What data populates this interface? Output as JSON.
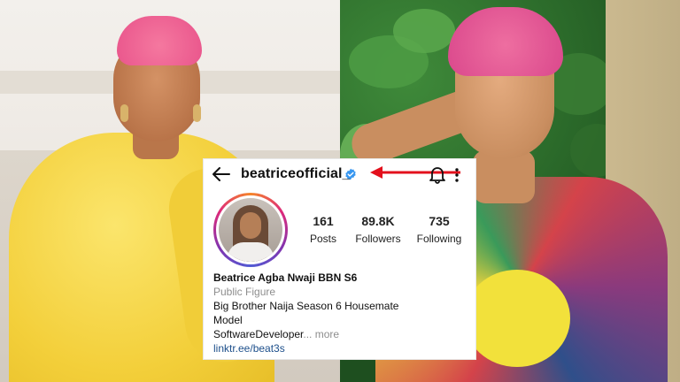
{
  "profile": {
    "username": "beatriceofficial_",
    "verified": true,
    "stats": {
      "posts": {
        "value": "161",
        "label": "Posts"
      },
      "followers": {
        "value": "89.8K",
        "label": "Followers"
      },
      "following": {
        "value": "735",
        "label": "Following"
      }
    },
    "bio": {
      "name": "Beatrice Agba Nwaji BBN S6",
      "category": "Public Figure",
      "line1": "Big Brother Naija Season 6 Housemate",
      "line2": "Model",
      "line3": "SoftwareDeveloper",
      "ellipsis": "...",
      "more": "more",
      "link": "linktr.ee/beat3s"
    }
  },
  "icons": {
    "back": "arrow-left-icon",
    "verified": "verified-badge-icon",
    "bell": "bell-icon",
    "more": "more-vertical-icon",
    "annotation": "red-arrow-icon"
  },
  "colors": {
    "verified_blue": "#3897f0",
    "annotation_red": "#e3101c",
    "link_blue": "#1d4f8b",
    "hair_pink": "#e8528a",
    "dress_yellow": "#f3cf3a"
  }
}
